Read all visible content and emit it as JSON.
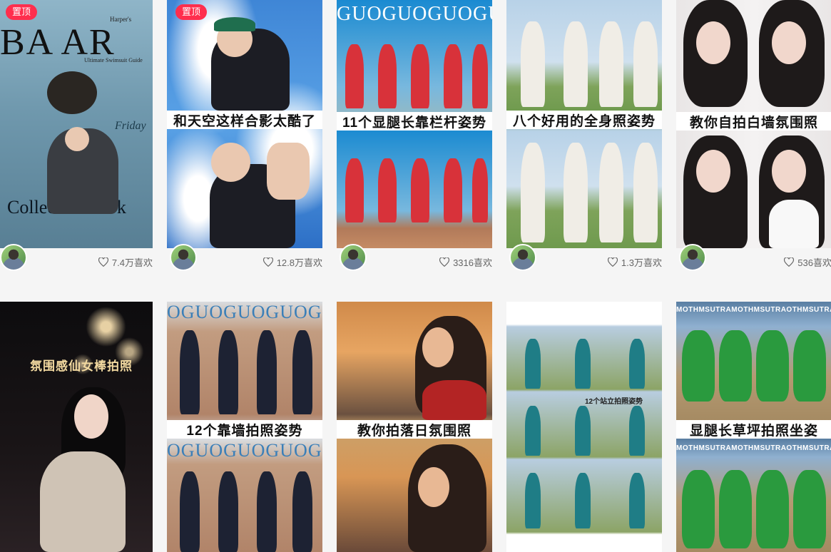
{
  "pin_label": "置顶",
  "notes": [
    {
      "title_lines": [
        "Harper's",
        "BA  AR",
        "Ultimate Swimsuit Guide",
        "Friday",
        "Collection book"
      ],
      "caption": "",
      "likes": "7.4万喜欢",
      "pinned": true
    },
    {
      "caption": "和天空这样合影太酷了",
      "likes": "12.8万喜欢",
      "pinned": true
    },
    {
      "banner": "GUOGUOGUOGUOGU",
      "caption": "11个显腿长靠栏杆姿势",
      "likes": "3316喜欢",
      "pinned": false
    },
    {
      "caption": "八个好用的全身照姿势",
      "likes": "1.3万喜欢",
      "pinned": false
    },
    {
      "caption": "教你自拍白墙氛围照",
      "likes": "536喜欢",
      "pinned": false
    },
    {
      "overlay": "氛围感仙女棒拍照",
      "pinned": false
    },
    {
      "banner": "OGUOGUOGUOGU",
      "caption": "12个靠墙拍照姿势",
      "pinned": false
    },
    {
      "caption": "教你拍落日氛围照",
      "pinned": false
    },
    {
      "overlay": "12个站立拍照姿势",
      "pinned": false
    },
    {
      "banner": "MOTHMSUTRAMOTHMSUTRAOTHMSUTRA",
      "caption": "显腿长草坪拍照坐姿",
      "pinned": false
    }
  ]
}
